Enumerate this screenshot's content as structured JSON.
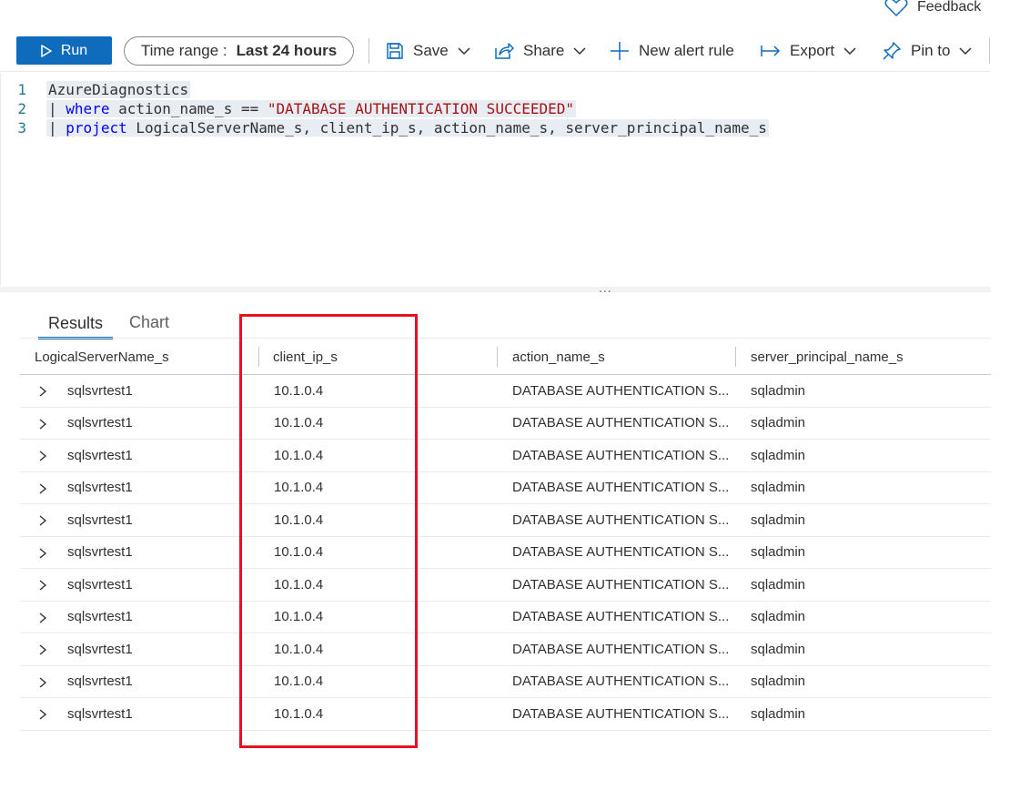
{
  "feedback": {
    "label": "Feedback"
  },
  "toolbar": {
    "run_label": "Run",
    "time_range_label": "Time range :",
    "time_range_value": "Last 24 hours",
    "save_label": "Save",
    "share_label": "Share",
    "new_alert_label": "New alert rule",
    "export_label": "Export",
    "pin_label": "Pin to"
  },
  "editor": {
    "line_numbers": [
      "1",
      "2",
      "3"
    ],
    "line1": "AzureDiagnostics",
    "line2_pipe": "|",
    "line2_kw": "where",
    "line2_rest": "action_name_s ==",
    "line2_str": "\"DATABASE AUTHENTICATION SUCCEEDED\"",
    "line3_pipe": "|",
    "line3_kw": "project",
    "line3_rest": "LogicalServerName_s, client_ip_s, action_name_s, server_principal_name_s"
  },
  "splitter": {
    "dots": "..."
  },
  "results": {
    "tabs": [
      {
        "label": "Results",
        "active": true
      },
      {
        "label": "Chart",
        "active": false
      }
    ],
    "columns": [
      "LogicalServerName_s",
      "client_ip_s",
      "action_name_s",
      "server_principal_name_s"
    ],
    "rows": [
      [
        "sqlsvrtest1",
        "10.1.0.4",
        "DATABASE AUTHENTICATION S...",
        "sqladmin"
      ],
      [
        "sqlsvrtest1",
        "10.1.0.4",
        "DATABASE AUTHENTICATION S...",
        "sqladmin"
      ],
      [
        "sqlsvrtest1",
        "10.1.0.4",
        "DATABASE AUTHENTICATION S...",
        "sqladmin"
      ],
      [
        "sqlsvrtest1",
        "10.1.0.4",
        "DATABASE AUTHENTICATION S...",
        "sqladmin"
      ],
      [
        "sqlsvrtest1",
        "10.1.0.4",
        "DATABASE AUTHENTICATION S...",
        "sqladmin"
      ],
      [
        "sqlsvrtest1",
        "10.1.0.4",
        "DATABASE AUTHENTICATION S...",
        "sqladmin"
      ],
      [
        "sqlsvrtest1",
        "10.1.0.4",
        "DATABASE AUTHENTICATION S...",
        "sqladmin"
      ],
      [
        "sqlsvrtest1",
        "10.1.0.4",
        "DATABASE AUTHENTICATION S...",
        "sqladmin"
      ],
      [
        "sqlsvrtest1",
        "10.1.0.4",
        "DATABASE AUTHENTICATION S...",
        "sqladmin"
      ],
      [
        "sqlsvrtest1",
        "10.1.0.4",
        "DATABASE AUTHENTICATION S...",
        "sqladmin"
      ],
      [
        "sqlsvrtest1",
        "10.1.0.4",
        "DATABASE AUTHENTICATION S...",
        "sqladmin"
      ]
    ]
  },
  "colors": {
    "accent": "#0f6cbd",
    "highlight": "#e81123"
  },
  "icons": {
    "feedback": "heart-icon",
    "run": "play-icon",
    "save": "save-icon",
    "share": "share-icon",
    "new_alert": "plus-icon",
    "export": "export-icon",
    "pin": "pin-icon",
    "dropdown": "chevron-down-icon",
    "expand": "chevron-right-icon"
  }
}
